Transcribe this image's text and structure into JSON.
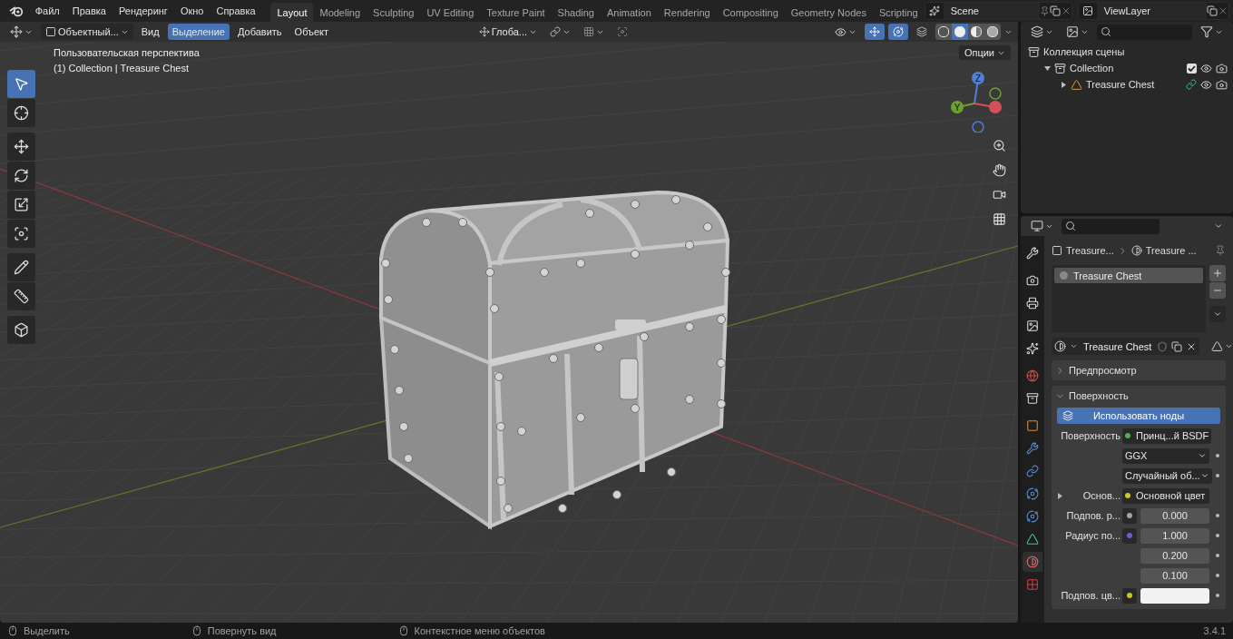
{
  "menu": [
    "Файл",
    "Правка",
    "Рендеринг",
    "Окно",
    "Справка"
  ],
  "workspaces": [
    {
      "label": "Layout",
      "selected": true
    },
    {
      "label": "Modeling",
      "selected": false
    },
    {
      "label": "Sculpting",
      "selected": false
    },
    {
      "label": "UV Editing",
      "selected": false
    },
    {
      "label": "Texture Paint",
      "selected": false
    },
    {
      "label": "Shading",
      "selected": false
    },
    {
      "label": "Animation",
      "selected": false
    },
    {
      "label": "Rendering",
      "selected": false
    },
    {
      "label": "Compositing",
      "selected": false
    },
    {
      "label": "Geometry Nodes",
      "selected": false
    },
    {
      "label": "Scripting",
      "selected": false
    }
  ],
  "scene": {
    "name": "Scene"
  },
  "view_layer": {
    "name": "ViewLayer"
  },
  "viewport_header": {
    "mode": "Объектный...",
    "menus": [
      {
        "label": "Вид",
        "selected": false
      },
      {
        "label": "Выделение",
        "selected": true
      },
      {
        "label": "Добавить",
        "selected": false
      },
      {
        "label": "Объект",
        "selected": false
      }
    ],
    "orientation": "Глоба...",
    "shading": [
      {
        "selected": false
      },
      {
        "selected": true
      },
      {
        "selected": false
      },
      {
        "selected": false
      }
    ]
  },
  "viewport": {
    "view_name": "Пользовательская перспектива",
    "info": "(1) Collection | Treasure Chest",
    "options": "Опции",
    "tools": [
      {
        "selected": true
      },
      {
        "selected": false
      },
      {
        "selected": false
      },
      {
        "selected": false
      },
      {
        "selected": false
      },
      {
        "selected": false
      },
      {
        "selected": false
      },
      {
        "selected": false
      },
      {
        "selected": false
      }
    ],
    "gizmo_labels": [
      "Z",
      "Y"
    ]
  },
  "outliner": {
    "items": [
      {
        "label": "Коллекция сцены",
        "children": [
          {
            "label": "Collection",
            "expanded": true,
            "checked": true,
            "children": [
              {
                "label": "Treasure Chest",
                "expanded": false
              }
            ]
          }
        ]
      }
    ]
  },
  "properties": {
    "tabs": [
      {
        "selected": false
      },
      {
        "selected": false
      },
      {
        "selected": false
      },
      {
        "selected": false
      },
      {
        "selected": false
      },
      {
        "selected": false
      },
      {
        "selected": false
      },
      {
        "selected": false
      },
      {
        "selected": false
      },
      {
        "selected": false
      },
      {
        "selected": false
      },
      {
        "selected": false
      },
      {
        "selected": false
      },
      {
        "selected": true
      },
      {
        "selected": false
      }
    ],
    "breadcrumb": [
      "Treasure...",
      "Treasure ..."
    ],
    "slots": [
      {
        "label": "Treasure Chest",
        "selected": true
      }
    ],
    "material": "Treasure Chest",
    "panels": [
      {
        "label": "Предпросмотр",
        "expanded": false
      },
      {
        "label": "Поверхность",
        "expanded": true
      }
    ],
    "use_nodes": "Использовать ноды",
    "rows": [
      {
        "kind": "socket",
        "label": "Поверхность",
        "value": "Принц...й BSDF",
        "color": "#4caf50"
      },
      {
        "kind": "dropdown",
        "value": "GGX"
      },
      {
        "kind": "dropdown",
        "value": "Случайный об..."
      },
      {
        "kind": "socket",
        "label": "Основ...",
        "value": "Основной цвет",
        "color": "#c7c729",
        "expanded": false
      },
      {
        "kind": "number",
        "label": "Подпов. р...",
        "color": "#a1a1a1",
        "values": [
          "0.000"
        ]
      },
      {
        "kind": "number",
        "label": "Радиус по...",
        "color": "#6363c7",
        "values": [
          "1.000",
          "0.200",
          "0.100"
        ]
      },
      {
        "kind": "swatch",
        "label": "Подпов. цв...",
        "color": "#c7c729"
      }
    ]
  },
  "status_bar": {
    "hints": [
      "Выделить",
      "Повернуть вид",
      "Контекстное меню объектов"
    ],
    "version": "3.4.1"
  }
}
